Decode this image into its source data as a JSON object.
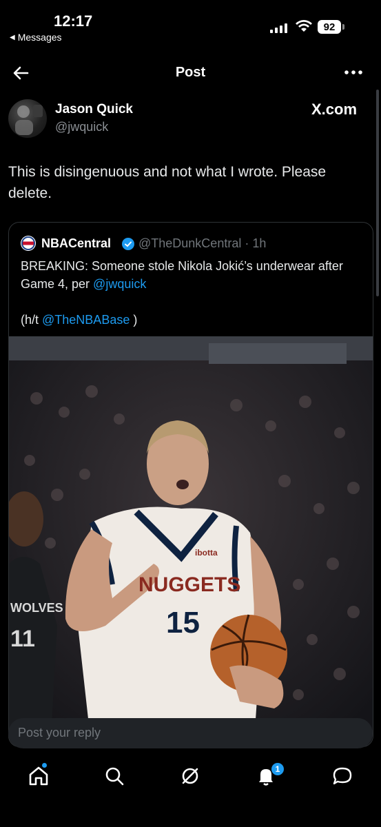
{
  "status_bar": {
    "time": "12:17",
    "back_app": "Messages",
    "battery": "92"
  },
  "header": {
    "title": "Post"
  },
  "post": {
    "author_name": "Jason Quick",
    "author_handle": "@jwquick",
    "source_brand": "X.com",
    "text": "This is disingenuous and not what I wrote. Please delete."
  },
  "quoted": {
    "name": "NBACentral",
    "handle_time": "@TheDunkCentral · 1h",
    "text_main": "BREAKING: Someone stole Nikola Jokić’s underwear after Game 4, per ",
    "mention_1": "@jwquick",
    "ht_prefix": "(h/t ",
    "mention_2": "@TheNBABase",
    "ht_suffix": " )",
    "image": {
      "jersey_team": "NUGGETS",
      "jersey_number": "15",
      "sponsor": "ibotta",
      "opponent_jersey": "WOLVES",
      "opponent_number": "11"
    }
  },
  "reply": {
    "placeholder": "Post your reply"
  },
  "nav": {
    "notifications_count": "1"
  },
  "colors": {
    "accent": "#1d9bf0",
    "background": "#000000",
    "muted": "#71767b"
  }
}
